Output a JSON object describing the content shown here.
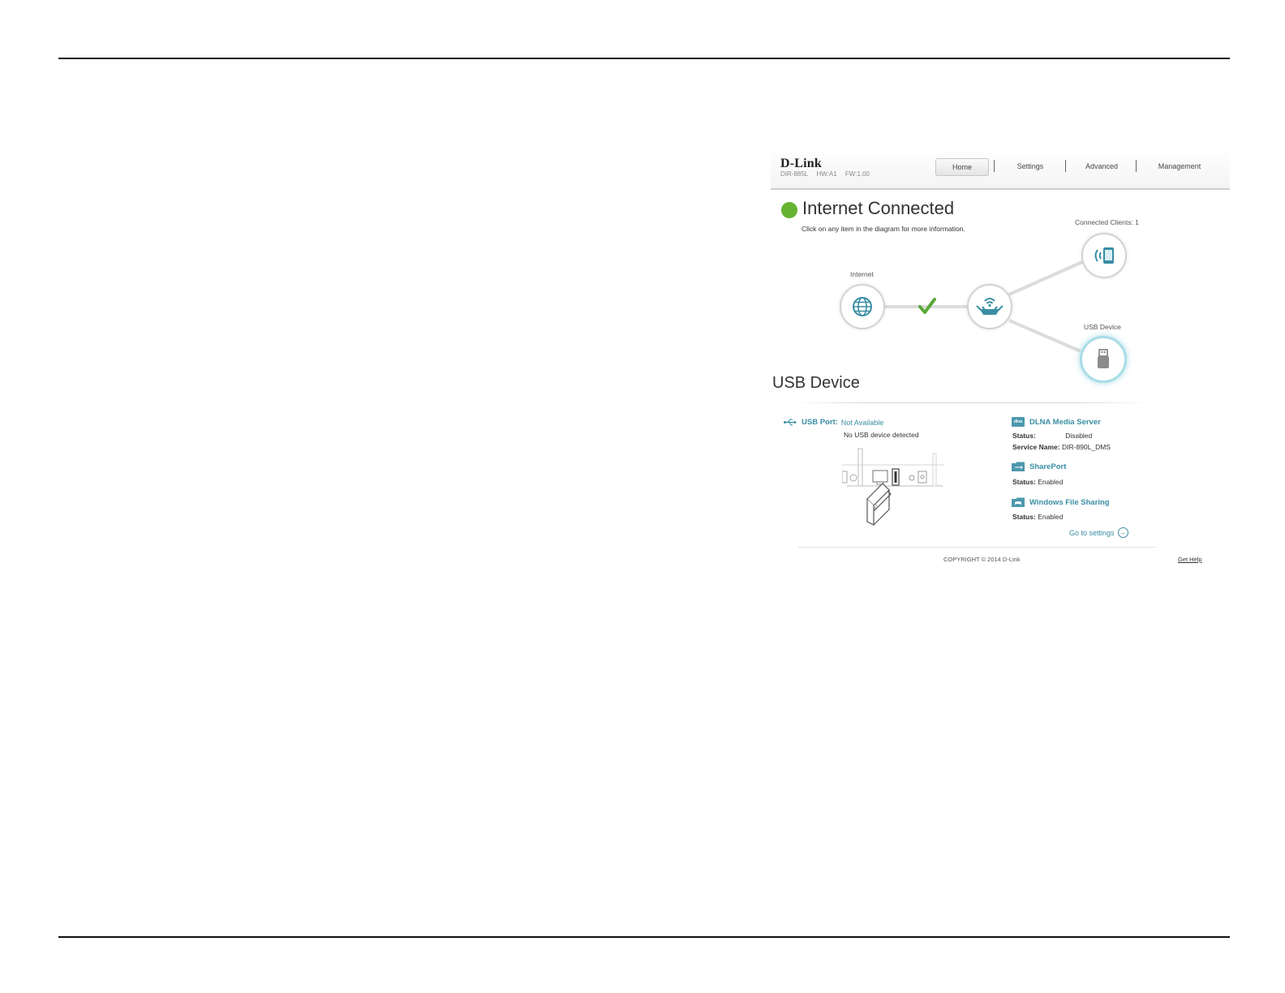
{
  "header": {
    "brand": "D-Link",
    "model": "DIR-885L",
    "hw": "HW:A1",
    "fw": "FW:1.00",
    "nav": {
      "home": "Home",
      "settings": "Settings",
      "advanced": "Advanced",
      "management": "Management"
    }
  },
  "status": {
    "title": "Internet Connected",
    "subtitle": "Click on any item in the diagram for more information.",
    "color": "#66b331"
  },
  "diagram": {
    "internet_label": "Internet",
    "clients_label": "Connected Clients: 1",
    "usb_label": "USB Device"
  },
  "usb_section": {
    "title": "USB Device",
    "port_key": "USB Port:",
    "port_value": "Not Available",
    "no_device": "No USB device detected"
  },
  "services": {
    "dlna": {
      "icon_text": "dlna",
      "title": "DLNA Media Server",
      "status_key": "Status:",
      "status_value": "Disabled",
      "service_key": "Service Name:",
      "service_value": "DIR-890L_DMS"
    },
    "shareport": {
      "title": "SharePort",
      "status_key": "Status:",
      "status_value": "Enabled"
    },
    "windows": {
      "title": "Windows File Sharing",
      "status_key": "Status:",
      "status_value": "Enabled"
    },
    "goto": "Go to settings"
  },
  "footer": {
    "copyright": "COPYRIGHT © 2014 D-Link",
    "help": "Get Help"
  },
  "colors": {
    "accent": "#3a8ea4",
    "ok": "#66b331"
  }
}
